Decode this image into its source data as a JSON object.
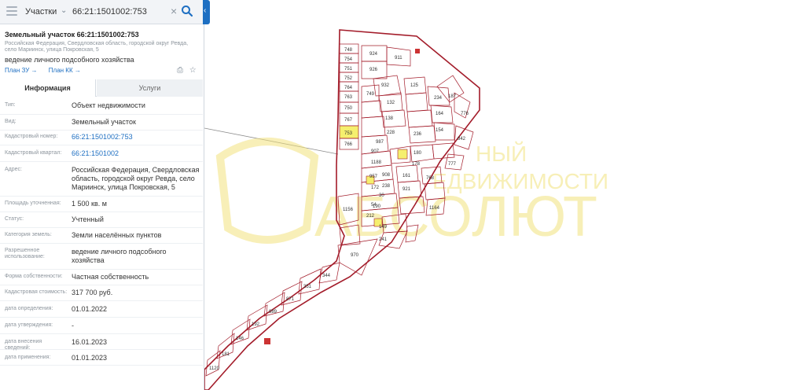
{
  "search": {
    "layer": "Участки",
    "query": "66:21:1501002:753",
    "clear_symbol": "×"
  },
  "object": {
    "title": "Земельный участок 66:21:1501002:753",
    "address_short": "Российская Федерация, Свердловская область, городской округ Ревда, село Мариинск, улица Покровская, 5",
    "usage": "ведение личного подсобного хозяйства",
    "link_zu": "План ЗУ →",
    "link_kk": "План КК →"
  },
  "tabs": {
    "info": "Информация",
    "services": "Услуги"
  },
  "fields": [
    {
      "label": "Тип:",
      "value": "Объект недвижимости"
    },
    {
      "label": "Вид:",
      "value": "Земельный участок"
    },
    {
      "label": "Кадастровый номер:",
      "value": "66:21:1501002:753"
    },
    {
      "label": "Кадастровый квартал:",
      "value": "66:21:1501002"
    },
    {
      "label": "Адрес:",
      "value": "Российская Федерация, Свердловская область, городской округ Ревда, село Мариинск, улица Покровская, 5"
    },
    {
      "label": "Площадь уточненная:",
      "value": "1 500 кв. м"
    },
    {
      "label": "Статус:",
      "value": "Учтенный"
    },
    {
      "label": "Категория земель:",
      "value": "Земли населённых пунктов"
    },
    {
      "label": "Разрешенное использование:",
      "value": "ведение личного подсобного хозяйства"
    },
    {
      "label": "Форма собственности:",
      "value": "Частная собственность"
    },
    {
      "label": "Кадастровая стоимость:",
      "value": "317 700 руб."
    },
    {
      "label": "дата определения:",
      "value": "01.01.2022"
    },
    {
      "label": "дата утверждения:",
      "value": "-"
    },
    {
      "label": "дата внесения сведений:",
      "value": "16.01.2023"
    },
    {
      "label": "дата применения:",
      "value": "01.01.2023"
    }
  ],
  "map": {
    "watermark_line1": "НЫЙ",
    "watermark_line2": "ЕДВИЖИМОСТИ",
    "watermark_big": "АБСОЛЮТ",
    "plot_labels_left": [
      "748",
      "754",
      "751",
      "752",
      "764",
      "763",
      "750",
      "767",
      "753",
      "766"
    ],
    "plot_labels_other": [
      "924",
      "911",
      "926",
      "932",
      "125",
      "749",
      "132",
      "234",
      "138",
      "164",
      "228",
      "987",
      "154",
      "907",
      "236",
      "1188",
      "957",
      "842",
      "180",
      "178",
      "777",
      "776",
      "187",
      "172",
      "908",
      "161",
      "238",
      "768",
      "190",
      "921",
      "30",
      "54",
      "212",
      "1164",
      "149",
      "241",
      "1156",
      "970",
      "344",
      "351",
      "871",
      "889",
      "192",
      "146",
      "181",
      "1120"
    ],
    "highlight_color": "#f5ef6e",
    "boundary_color": "#a31c2a"
  }
}
